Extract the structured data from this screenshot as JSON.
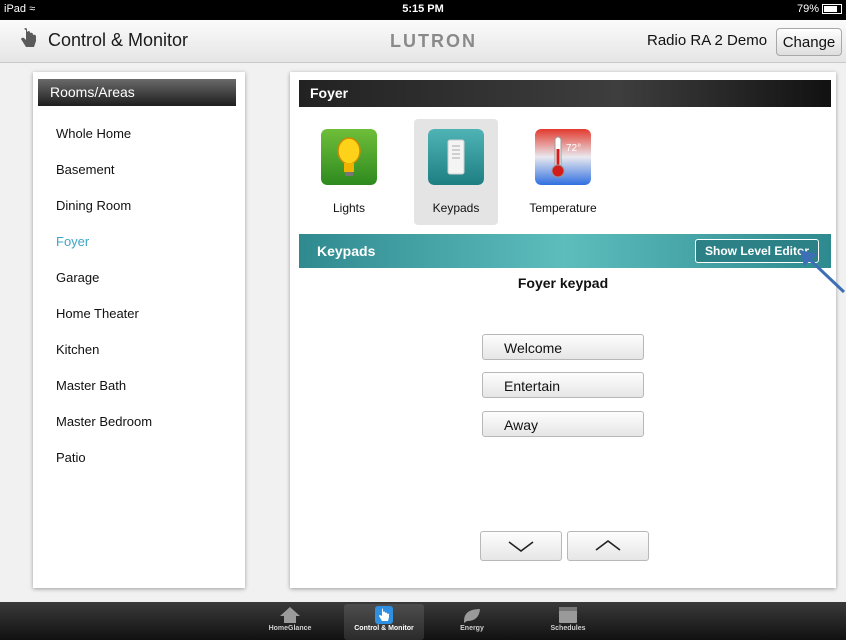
{
  "status_bar": {
    "device": "iPad",
    "time": "5:15 PM",
    "battery": "79%",
    "battery_level": 0.79
  },
  "header": {
    "title": "Control & Monitor",
    "brand": "LUTRON",
    "site_name": "Radio RA 2 Demo",
    "change_label": "Change"
  },
  "rooms": {
    "heading": "Rooms/Areas",
    "items": [
      "Whole Home",
      "Basement",
      "Dining Room",
      "Foyer",
      "Garage",
      "Home Theater",
      "Kitchen",
      "Master Bath",
      "Master Bedroom",
      "Patio"
    ],
    "selected": "Foyer"
  },
  "room_panel": {
    "title": "Foyer",
    "categories": [
      {
        "label": "Lights",
        "icon": "light-bulb-icon"
      },
      {
        "label": "Keypads",
        "icon": "keypad-icon"
      },
      {
        "label": "Temperature",
        "icon": "thermometer-icon",
        "readout": "72°"
      }
    ],
    "selected_category": "Keypads"
  },
  "keypads": {
    "title": "Keypads",
    "level_editor_label": "Show Level Editor",
    "keypad_name": "Foyer keypad",
    "buttons": [
      "Welcome",
      "Entertain",
      "Away"
    ]
  },
  "tabs": [
    {
      "label": "HomeGlance",
      "icon": "home-icon"
    },
    {
      "label": "Control & Monitor",
      "icon": "hand-pointer-icon"
    },
    {
      "label": "Energy",
      "icon": "energy-leaf-icon"
    },
    {
      "label": "Schedules",
      "icon": "calendar-icon"
    }
  ],
  "colors": {
    "accent": "#3ca6c6",
    "teal_header": "#3fa3a6",
    "dark_header": "#2b2b2b"
  }
}
